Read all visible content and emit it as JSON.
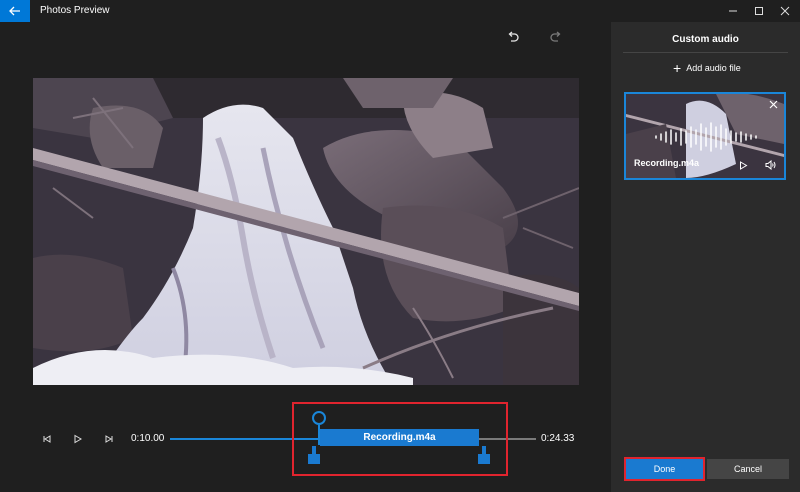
{
  "app": {
    "title": "Photos Preview"
  },
  "window_controls": [
    "minimize",
    "maximize",
    "close"
  ],
  "editor": {
    "undo_icon": "undo-icon",
    "redo_icon": "redo-icon"
  },
  "timeline": {
    "start_time": "0:10.00",
    "end_time": "0:24.33",
    "clip_label": "Recording.m4a"
  },
  "panel": {
    "title": "Custom audio",
    "add_audio_label": "Add audio file",
    "card": {
      "name": "Recording.m4a"
    },
    "done_label": "Done",
    "cancel_label": "Cancel"
  },
  "colors": {
    "accent": "#1a7ad0",
    "highlight": "#e0242e",
    "background": "#1f1f1f",
    "panel": "#2b2b2b"
  }
}
